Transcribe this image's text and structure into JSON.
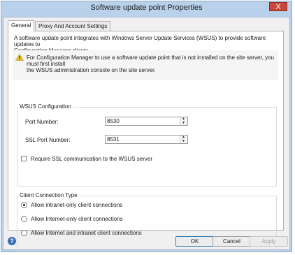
{
  "window": {
    "title": "Software update point Properties",
    "close_glyph": "X"
  },
  "tabs": [
    {
      "label": "General",
      "active": true
    },
    {
      "label": "Proxy And Account Settings",
      "active": false
    }
  ],
  "general": {
    "intro_line1": "A software update point integrates with Windows Server Update Services (WSUS) to provide software updates to",
    "intro_line2": "Configuration Manager clients.",
    "warning_line1": "For Configuration Manager to use a software update point that is not installed on the site server, you must first install",
    "warning_line2": "the WSUS administration console on the site server.",
    "warning_icon": "warning-icon"
  },
  "wsus": {
    "group_title": "WSUS Configuration",
    "port_label": "Port Number:",
    "port_value": "8530",
    "ssl_port_label": "SSL Port Number:",
    "ssl_port_value": "8531",
    "require_ssl_label": "Require SSL communication to the WSUS server",
    "require_ssl_checked": false
  },
  "client_connection": {
    "group_title": "Client Connection Type",
    "options": [
      {
        "label": "Allow intranet-only client connections",
        "selected": true
      },
      {
        "label": "Allow Internet-only client connections",
        "selected": false
      },
      {
        "label": "Allow Internet and intranet client connections",
        "selected": false
      }
    ]
  },
  "buttons": {
    "ok": "OK",
    "cancel": "Cancel",
    "apply": "Apply",
    "help_glyph": "?"
  },
  "colors": {
    "titlebar": "#b9d1ea",
    "close_button": "#c9483b",
    "help_icon": "#3a6fb7"
  }
}
